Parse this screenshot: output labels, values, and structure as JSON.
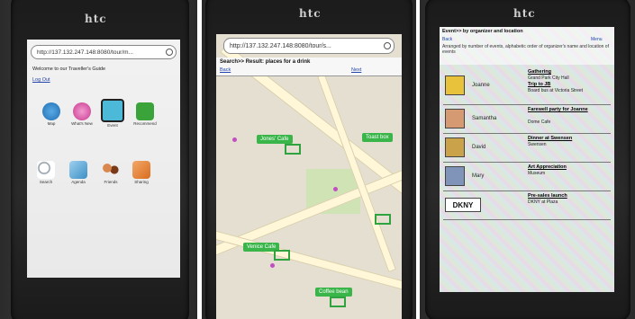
{
  "screen1": {
    "brand": "htc",
    "url": "http://137.132.247.148:8080/tour/m...",
    "welcome": "Welcome to our Traveller's Guide",
    "logout": "Log Out",
    "apps": [
      {
        "label": "Map",
        "icon": "map-icon",
        "color": "#1f6fb2"
      },
      {
        "label": "What's New",
        "icon": "whats-new-icon",
        "color": "#c8378f"
      },
      {
        "label": "Event",
        "icon": "event-icon",
        "color": "#d9b52a"
      },
      {
        "label": "Recommend",
        "icon": "recommend-icon",
        "color": "#3aa33a"
      },
      {
        "label": "Search",
        "icon": "search-icon",
        "color": "#7d8a96"
      },
      {
        "label": "Agenda",
        "icon": "agenda-icon",
        "color": "#3c8fc5"
      },
      {
        "label": "Friends",
        "icon": "friends-icon",
        "color": "#b3572b"
      },
      {
        "label": "Sharing",
        "icon": "sharing-icon",
        "color": "#d96c1e"
      }
    ]
  },
  "screen2": {
    "brand": "htc",
    "url": "http://137.132.247.148:8080/tour/s...",
    "header": "Search>> Result: places for a drink",
    "back": "Back",
    "next": "Next",
    "places": [
      "Jones' Cafe",
      "Toast box",
      "Venice Cafe",
      "Coffee bean"
    ]
  },
  "screen3": {
    "brand": "htc",
    "header": "Event>> by organizer and location",
    "back": "Back",
    "menu": "Menu",
    "subtitle": "Arranged by number of events, alphabetic order of organizer's name and location of events",
    "rows": [
      {
        "organizer": "Joanne",
        "avatar_color": "#e8c23a",
        "events": [
          {
            "title": "Gathering",
            "sub": "Grand Park City Hall"
          },
          {
            "title": "Trip to JB",
            "sub": "Board bus at Victoria Street"
          }
        ]
      },
      {
        "organizer": "Samantha",
        "avatar_color": "#d59a72",
        "events": [
          {
            "title": "Farewell party for Joanne",
            "sub": "Dome Cafe"
          }
        ]
      },
      {
        "organizer": "David",
        "avatar_color": "#c9a24a",
        "events": [
          {
            "title": "Dinner at Swensen",
            "sub": "Swensen"
          }
        ]
      },
      {
        "organizer": "Mary",
        "avatar_color": "#7f94b8",
        "events": [
          {
            "title": "Art Appreciation",
            "sub": "Museum"
          }
        ]
      },
      {
        "organizer": "DKNY",
        "avatar_color": "#ffffff",
        "events": [
          {
            "title": "Pre-sales launch",
            "sub": "DKNY at Plaza"
          }
        ]
      }
    ]
  }
}
